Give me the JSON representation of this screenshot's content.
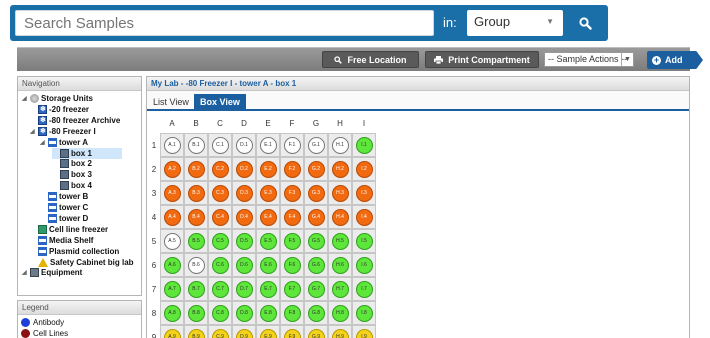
{
  "search": {
    "placeholder": "Search Samples",
    "value": "",
    "in_label": "in:",
    "scope": "Group"
  },
  "toolbar": {
    "free_location_label": "Free Location",
    "print_compartment_label": "Print Compartment",
    "sample_actions_label": "-- Sample Actions --",
    "add_label": "Add"
  },
  "navigation": {
    "title": "Navigation",
    "items": [
      {
        "label": "Storage Units",
        "icon": "storage-units-icon",
        "level": 0
      },
      {
        "label": "-20 freezer",
        "icon": "freezer-icon",
        "level": 1
      },
      {
        "label": "-80 freezer Archive",
        "icon": "freezer-icon",
        "level": 1
      },
      {
        "label": "-80 Freezer I",
        "icon": "freezer-icon",
        "level": 1
      },
      {
        "label": "tower A",
        "icon": "shelf-icon",
        "level": 2
      },
      {
        "label": "box 1",
        "icon": "box-icon",
        "level": 3,
        "selected": true
      },
      {
        "label": "box 2",
        "icon": "box-icon",
        "level": 3
      },
      {
        "label": "box 3",
        "icon": "box-icon",
        "level": 3
      },
      {
        "label": "box 4",
        "icon": "box-icon",
        "level": 3
      },
      {
        "label": "tower B",
        "icon": "shelf-icon",
        "level": 2
      },
      {
        "label": "tower C",
        "icon": "shelf-icon",
        "level": 2
      },
      {
        "label": "tower D",
        "icon": "shelf-icon",
        "level": 2
      },
      {
        "label": "Cell line freezer",
        "icon": "cell-freezer-icon",
        "level": 1
      },
      {
        "label": "Media Shelf",
        "icon": "shelf-icon",
        "level": 1
      },
      {
        "label": "Plasmid collection",
        "icon": "shelf-icon",
        "level": 1
      },
      {
        "label": "Safety Cabinet big lab",
        "icon": "warning-icon",
        "level": 1
      },
      {
        "label": "Equipment",
        "icon": "equipment-icon",
        "level": 0
      }
    ]
  },
  "legend": {
    "title": "Legend",
    "items": [
      {
        "label": "Antibody",
        "color": "#1f3fd6"
      },
      {
        "label": "Cell Lines",
        "color": "#8b1010"
      }
    ]
  },
  "breadcrumb": {
    "path": "My Lab - -80 Freezer I - tower A - box 1"
  },
  "tabs": [
    {
      "label": "List View",
      "active": false
    },
    {
      "label": "Box View",
      "active": true
    }
  ],
  "box": {
    "columns": [
      "A",
      "B",
      "C",
      "D",
      "E",
      "F",
      "G",
      "H",
      "I"
    ],
    "rows": [
      "1",
      "2",
      "3",
      "4",
      "5",
      "6",
      "7",
      "8",
      "9"
    ],
    "colors": {
      "empty": "#ffffff",
      "orange": "#f26a10",
      "green": "#5ee63b",
      "yellow": "#f2d21a"
    },
    "wells": [
      [
        "empty",
        "empty",
        "empty",
        "empty",
        "empty",
        "empty",
        "empty",
        "empty",
        "green"
      ],
      [
        "orange",
        "orange",
        "orange",
        "orange",
        "orange",
        "orange",
        "orange",
        "orange",
        "orange"
      ],
      [
        "orange",
        "orange",
        "orange",
        "orange",
        "orange",
        "orange",
        "orange",
        "orange",
        "orange"
      ],
      [
        "orange",
        "orange",
        "orange",
        "orange",
        "orange",
        "orange",
        "orange",
        "orange",
        "orange"
      ],
      [
        "empty",
        "green",
        "green",
        "green",
        "green",
        "green",
        "green",
        "green",
        "green"
      ],
      [
        "green",
        "empty",
        "green",
        "green",
        "green",
        "green",
        "green",
        "green",
        "green"
      ],
      [
        "green",
        "green",
        "green",
        "green",
        "green",
        "green",
        "green",
        "green",
        "green"
      ],
      [
        "green",
        "green",
        "green",
        "green",
        "green",
        "green",
        "green",
        "green",
        "green"
      ],
      [
        "yellow",
        "yellow",
        "yellow",
        "yellow",
        "yellow",
        "yellow",
        "yellow",
        "yellow",
        "yellow"
      ]
    ]
  }
}
